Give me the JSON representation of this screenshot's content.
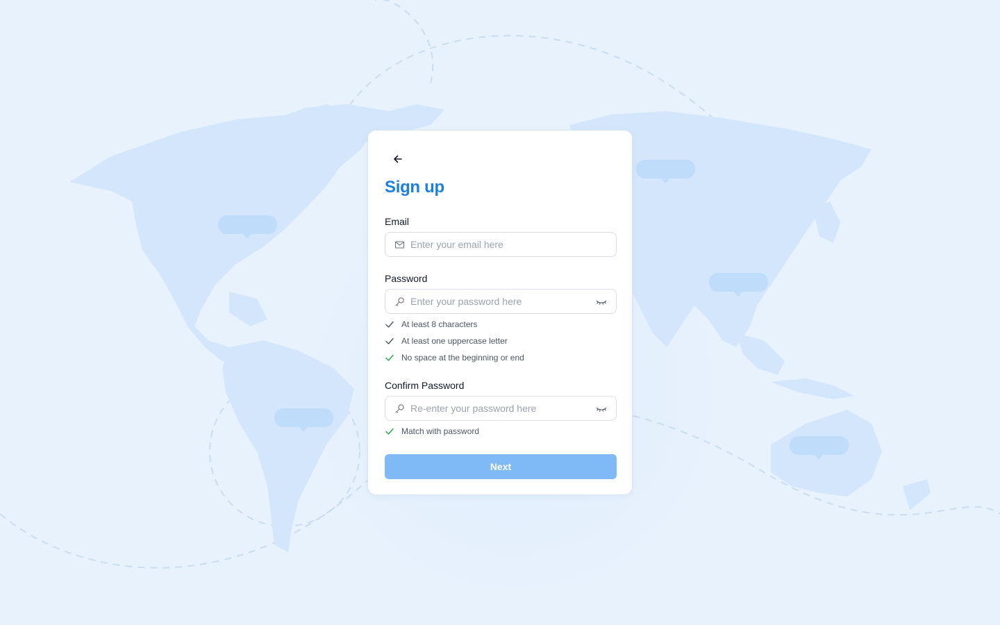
{
  "form": {
    "title": "Sign up",
    "email_label": "Email",
    "email_placeholder": "Enter your email here",
    "email_value": "",
    "password_label": "Password",
    "password_placeholder": "Enter your password here",
    "password_value": "",
    "password_rules": [
      {
        "text": "At least 8 characters",
        "status": "neutral"
      },
      {
        "text": "At least one uppercase letter",
        "status": "neutral"
      },
      {
        "text": "No space at the beginning or end",
        "status": "valid"
      }
    ],
    "confirm_label": "Confirm Password",
    "confirm_placeholder": "Re-enter your password here",
    "confirm_value": "",
    "confirm_rules": [
      {
        "text": "Match with password",
        "status": "valid"
      }
    ],
    "next_label": "Next"
  },
  "icons": {
    "back": "arrow-left-icon",
    "email": "envelope-icon",
    "password": "key-icon",
    "toggle": "eye-closed-icon",
    "rule": "check-icon"
  },
  "colors": {
    "accent": "#1a7fe6",
    "button_disabled": "#7fb9f6",
    "valid": "#22a447",
    "neutral": "#4b5563",
    "background": "#e8f2fd"
  }
}
